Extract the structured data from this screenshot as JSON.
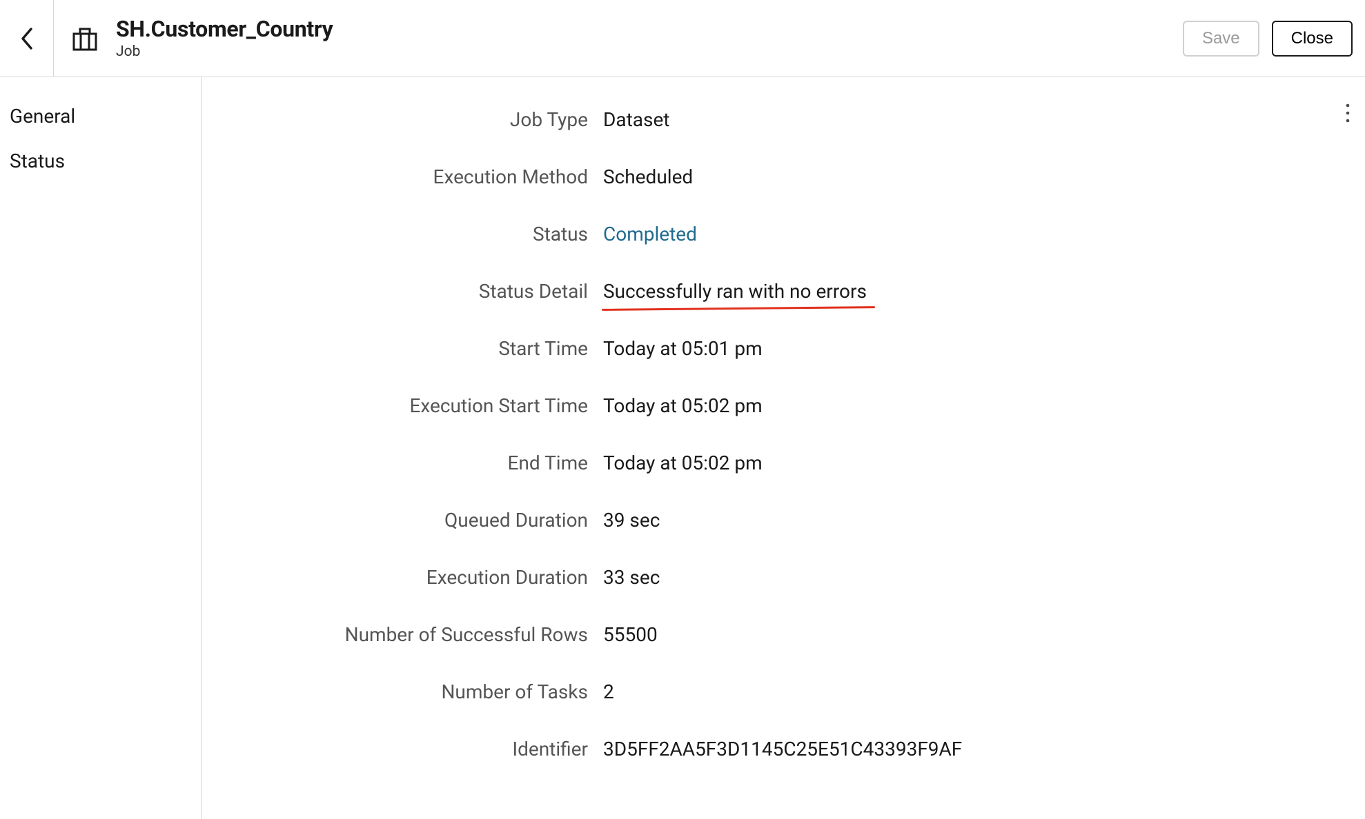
{
  "header": {
    "title": "SH.Customer_Country",
    "subtitle": "Job",
    "save_label": "Save",
    "close_label": "Close"
  },
  "sidebar": {
    "items": [
      {
        "label": "General"
      },
      {
        "label": "Status"
      }
    ]
  },
  "details": {
    "rows": [
      {
        "label": "Job Type",
        "value": "Dataset",
        "link": false,
        "annot": false
      },
      {
        "label": "Execution Method",
        "value": "Scheduled",
        "link": false,
        "annot": false
      },
      {
        "label": "Status",
        "value": "Completed",
        "link": true,
        "annot": false
      },
      {
        "label": "Status Detail",
        "value": "Successfully ran with no errors",
        "link": false,
        "annot": true
      },
      {
        "label": "Start Time",
        "value": "Today at 05:01 pm",
        "link": false,
        "annot": false
      },
      {
        "label": "Execution Start Time",
        "value": "Today at 05:02 pm",
        "link": false,
        "annot": false
      },
      {
        "label": "End Time",
        "value": "Today at 05:02 pm",
        "link": false,
        "annot": false
      },
      {
        "label": "Queued Duration",
        "value": "39 sec",
        "link": false,
        "annot": false
      },
      {
        "label": "Execution Duration",
        "value": "33 sec",
        "link": false,
        "annot": false
      },
      {
        "label": "Number of Successful Rows",
        "value": "55500",
        "link": false,
        "annot": false
      },
      {
        "label": "Number of Tasks",
        "value": "2",
        "link": false,
        "annot": false
      },
      {
        "label": "Identifier",
        "value": "3D5FF2AA5F3D1145C25E51C43393F9AF",
        "link": false,
        "annot": false
      }
    ]
  }
}
